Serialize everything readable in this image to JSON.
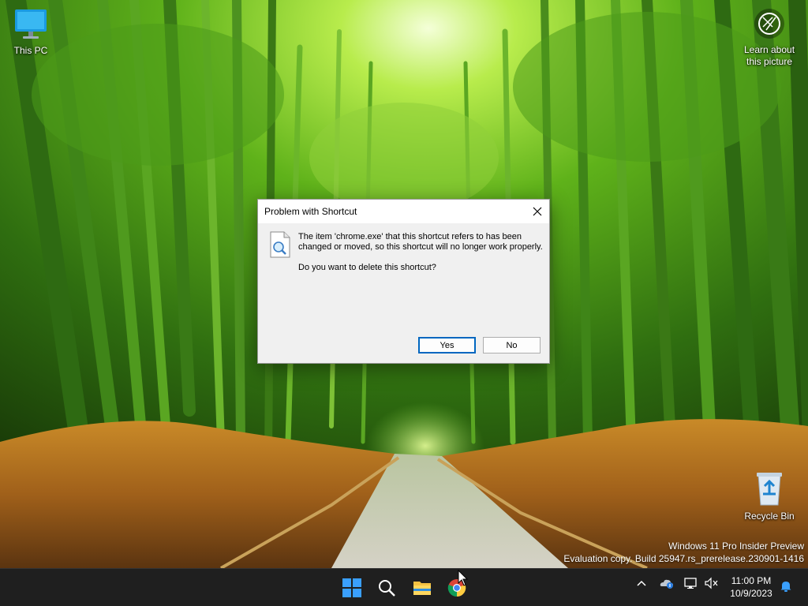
{
  "desktop": {
    "icons": [
      {
        "label": "This PC"
      },
      {
        "label": "Recycle Bin"
      }
    ],
    "learn_about": "Learn about this picture",
    "watermark": {
      "line1": "Windows 11 Pro Insider Preview",
      "line2": "Evaluation copy. Build 25947.rs_prerelease.230901-1416"
    }
  },
  "dialog": {
    "title": "Problem with Shortcut",
    "message": "The item 'chrome.exe' that this shortcut refers to has been changed or moved, so this shortcut will no longer work properly.",
    "question": "Do you want to delete this shortcut?",
    "buttons": {
      "yes": "Yes",
      "no": "No"
    },
    "icon": "document-search-icon"
  },
  "taskbar": {
    "apps": [
      "windows-start-icon",
      "search-icon",
      "file-explorer-icon",
      "chrome-icon"
    ],
    "tray_icons": [
      "chevron-up-icon",
      "onedrive-icon",
      "network-icon",
      "volume-muted-icon"
    ],
    "clock": {
      "time": "11:00 PM",
      "date": "10/9/2023"
    },
    "notification_icon": "bell-icon"
  },
  "colors": {
    "accent": "#0067c0",
    "taskbar_bg": "#1f1f1f",
    "dialog_bg": "#f0f0f0"
  }
}
